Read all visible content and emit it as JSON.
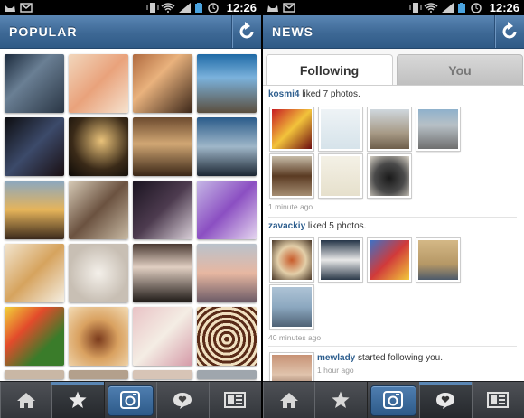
{
  "status": {
    "time": "12:26"
  },
  "popular": {
    "title": "POPULAR",
    "refresh_icon": "refresh-icon"
  },
  "news": {
    "title": "NEWS",
    "refresh_icon": "refresh-icon",
    "tabs": [
      {
        "label": "Following",
        "active": true
      },
      {
        "label": "You",
        "active": false
      }
    ],
    "stories": [
      {
        "user": "kosmi4",
        "action": " liked 7 photos.",
        "time": "1 minute ago",
        "photo_count": 7
      },
      {
        "user": "zavackiy",
        "action": " liked 5 photos.",
        "time": "40 minutes ago",
        "photo_count": 5
      },
      {
        "user": "mewlady",
        "action": " started following you.",
        "time": "1 hour ago"
      }
    ]
  },
  "photo_thumbs": [
    "R0lGODlhUgBOAPcAAAQCBAQGBAQKBAQOBAQSBAwGBAwKBAwOBAwSDAQKDAQODAQSDAQWDAwKDAwOBAwOFAwWDAwaFAwWHAweFAQeFAwiFAwiHBQODBQSDBQWDBwSDBQOBBQSBBQWBBwWFBwaFBweFBQeHBQiHBQiFBQmHBQmFBQqHBwiHBwmHBwuHBwmFBwqJBwuJBwyJCQaFCQeFCQiHCwiHCwmHCQmHCQqJCQuJCQyJCw2JCQ2JCQ6LCw6LCwyLCwuJCwqJDQ6LDQuJDQyLDQ2LCw+LDQ+LDw+NCQ+LDRCNCxCNDxCNDRGNDxKNDxGPDxGNDxCPDxKPDROPDRSPDxSPEROPEROREQ+PEQ6NEQ2LExCPEhGPERGRExKPExKRFRCPFRORFxKTFRKPFRGPFxSTGRKRGxSRGxOPHRWRHxWTIReVHxeTHxaVGRSTGRaVFxaVExWTExSRERWVERaTERWTExaTExSTExaVERSTERiTERiVExqXExeVExiVEx2XExyXEx2ZExuXExmVERmVERaVFRiXFRqZFR2ZFRmXFRyZFx2ZFxuZFxqZFxiXFR+bFyCdFR+dGRiXGxiXGxqXGRyXGR2bGRqZGx2bGR+dGx+dGR6bGRubHRubGxybHRybHx2dHR+dHx+dHR2bIR6dIR2bIR+fHyCfHyCdHSCfIyCfIR+dGyGfGyKfGySfGyKhHSGhHSKhHyKhHSShHyKjHyGhHySjISGhIyGhISKfISSjISOhISOjIySjIyWjJSGhJyOjKSWlIySlIyWlJSOjJSSjJSSlJyalJSalJSWjJyWjKSalKyalKyWlKSenJyinJyelJSmnJyqpJSipIyinISejISWlHyalHyelISinIymnJSupJyupKSmnKSupKSinKyipLymnLyqpLSqnLSinKyqnKyupLSupMyyrMSyrLyurLSyrKSytKy2tLS6tLy2tLSyrMS6tMy6tNS+tMy2rNzGvNzCvOTGvNTCtMS+vMzCvMzGvMzKvNTOxNTGvMzGxMTCvMTCtMzKxNTOzNTKxNTGxNzKxNzOxOTOxNzSxNzOzNzSzNTSzOTOzOzSzOzazOzazOTazOTWzOTW1OzW1OTa1Oze1PTe1Pzm3Pzi3PTi3PTm3PTe3Ozi3Pz+/AAAAAAAAAAAAAAAAAAAAAAAAAAAAAAAAAAAAAAAAAAAAAAAAAAAAAAAAAAAAAAAAAAAAAAAAAAAAAAAAAAAAAAAAAAAAAAAAAAAAAAAAAAAAAAAAAAAAAAAAAAAAAAAAAAAAAAAAAAAACH5BAEAAP8ALAAAAABSAE4AAAj/AP0JHEiwoMGDCBMqXMiwocOEACJKjEiRYkOIFitm3Agxo8WPIEOKHEmSY0WLKFOqXMmyZUqNEmFqfDmwpsubOHPqtMkzJMigQoMSHUq0qNGjSJMqXcr0aNOPO/XR3MlPnz590SJN+vdsUiR+9KhdMxfrX7tj4KRN+GfuWDNi0cpVm0SXLt1V1f6xUwVt0lOngAMLHky4sGHDPKMMLOcPaoAD+qBB65du3bd2m4Q924fv3z5vw3hFu8xP3b9z5oypw3dOXjps4M6dG5QOW7lwwhY5Hr1u1TNnmEx9KkS8uHHjUdPp3m1s0jp96Pjxw8ZvHT4kcdTp6+dPUjpz/MLx/8M2SfO+WOxDZ8vWbZ8mC5LWxfJnUyhj9ZM4saPkDhs+cAC6J+CA+tz3Xj59PNPOOe3MYUMMvESwzR/zzMNOIN10Y4U/lwT7Tiy8AQvtOu/IkgxzFOlSjCp/2KMKHdBw8kwrGjBgASU0HYOLc/PQ+HuI/gIxsTRZy3I0KQCHFhLMrq0k04+iy67GD+kvPIlPcUEGo2+qzoQ0PghMNLQhAQkcUdOlt8Qd3gADP/4QyM/8/zTD8JcAgeQ9Q8Gq0dWckKi21Q34UvLRCzz7PFDCAT7UwsB+l78X/D6EsjqSD5q+HHDDFE+vQhwEHDy1vPMKKjhXJqF1QB68wDQa+WB9DKhDkixFMOYIB/Ayj0ZrtJIM8Cc04rA8IcT/QDNxxjh+2/xkA/eNjS+hDEjFHLqQsGxGDC+aJvMVpYixEnBMIPvkI8pBD4RQgAGEUoMq08GdcFNmEAGvGNnPuRQ5EsMhNLHlZUA88+CBTSCH6wUoVpCOQP8ZHQMcFC7MCkAqlNlglPcTMk4UZUqC+rjRNCjcNLLA8+pAnmwP2Ajr8YFTWVBgBjYJPI/z/FY5bfTUJXgbBpfAIoLAx+JMlNFPLBfkYm4L5xxBFGeO9gi3yCQbzjY6fHRPCoE0YdNeHDWsDKD1RfLHxKu+Dx7a5e2AwgwXTTKdmCjCHGhfBjcUbrt2STVAcA3fwwcG0LXdq4Bw7dYAJ2ALO84JjwcJMfMJNA5hhfGuoZS8BWo7sj8gRSwCbwpHChPBYFIhVTLXc4LwEBgAYhoQgSCAN4gLP4iB2KQcpA3fcagWyzvbbbcGJ/DZPvJfBBrIHt1d8eOpzbQT7y3SePNRwBdfnChI/6SqUdrBfG6YVUVRTcs0+g3yDV8ZRD6gcwQKwaaPQ8DWwKgtEQE7ACnEZTwm37oULAGRkGwF4gjCmJYVIzhnSJc4WA3xhAeDyKAnCA9ygDgMUAlYPX77fw7HWIr4gB4/ZHAXfe8Afh8JfPfKQ3+Iu4KxoHqvj+mQMTDgcgr3A2H6+8/Ax6ImQEjGQB+pjBwzH1qUFh5pxoUgAPR4NgnEVNlXULcoHoaXi4AiLnYg2CHnYVvEWYt4xpJBUkvd6M04CYg/Lxq1j0o1nYcC4tZABMiDeBnmDtB4iFXQkBo9KpjjtfKv0o8CCRXEBbIvmz5akEwu2dGwLI4hEAIw9nfSlvtzU1kiVw+5m0yrTw2Ze8xgdDjdqxNxFAcv+OpybJk3wD5HHIhObsWBlI6T7x/Sl/FVGGtHXpUtlSA6SHgCIx1aXuzBhpZQdEwnBR4TcBMskkJIc9fyUJ3Q9RDJ+NT3PcAImtVExXEzuRnxB6Ib8aDK6p3LBAAAP3fAhV9nlZ4AoTAAVQxwiBxrAsOiGn1gT+OmWHF6PaT5m+9YKglNe9RmTLwHp5dYyrT1QTJ82/+B96uQu2f5NVgr/Dw78NiPB7FlGuFKx9YyjgsUFixe2NsHwagZI5xoAlOGpEEFkkZBYOVSsvXzvd2Z0hEuq73m78kVcHE4BP+PD6TjWbG/ezzlBW4BQaxxd2E3w0O7BZJbUyfeU8umZhaI0HUWnLQQ0/C0uvVRJm8TRcAdCTd5t6TYwwAUvEq4TQgBIw+KIONSZvv8rHzkg+xEgn8AaYgCGUsKXc6YnTjDBAwdDYj3Q6VGRiS3V9Z3tqkbCrjNp/n42Qj5kQ1goUa1bT7ADpWwokfCzyc6HLEP7dOrfpHa1sy7pEkjCaN7QKOBdrN+JRZ69s0R5iIOVzX2jbhP0gpK0vLaw1VrzP6HsDTcCSVb4Ie3+Mb4ofs7q4h6PDTfZ2BttkMdXLkYYjy9yAJKCYnsmpJzsXtHCXRN0XpjKNa+ee5y69/OPFcwNGazpFkUnzj0+PeGsXjeIe+FiJiJuLpxVjZbbJSW+/8e1i1+gkjeGznb4+BhhFhRfoWgHtNlrBYcmo2IVZHpfPFXdj8cQm3rSf9X4Fj0xlYfX5ceh/OAgaP7XfbVepiqRiDDsnVK0yEwzk7/ZwjhkYdOfH5yVlcCrwt0Zpdp42FqzHkFFo1/cJVTizTDGdVZZlPhz1AVaLMOl5WrKM8hMtxSdfmvPmdhOb/wnShVB6uEbXVGJmLjajcxFJOF1Tx+L5bs1kK1Wv3bhIVcxDFBtknRuomC1ARWqeupK9Lp6jxhcqHDQxYvhNt+z61Ft/GlGeVbXjVK+sZ7WmENUtVh11CaH9pb80RmsuTCUyX+bvO30uGi1NgIXYNlaQ35A4B3wN7rvsfd3BLL2ad/PD3j+kzvlvR6Y+ZPT9lpVfncF+XtIuo9yf1t97vfg/x/sKZO6nypXv0qTyXkwg/fY19MwYvM39lwTfRC3h8Mtq9tffNPfX+XPvPzq1H1SsPn2feZHDwqzk5lodxnM7n3FSnPnMoy2j55k2wcNnl/3XPI/uT5tbU0n3o3n8Nwtq+vJ8+yb9LaHDQbi8EFOMvrvZH1j4pmt7RjYyT5ePlX+hdonmx/YV9WYd7oxIsFlzT2OqFR0Hyw1tnZPLn/m9Ti7fhLnxkoHr12fw67d/fzyPZx7u0wmjd28B8+4Xzmr2e/+N9R/+AOZd2enlk92ZTKPvn6OMnYjr5umLmm3tbaM+zj3TLHfaB4P3wH7mr/tvVKlG9Ny//mn+92vm3vf6xf37V8f6I07d5bS9+x8+tD2jt2/9sb/56fn9+eH9BGntjEGP+9Nd/fWDe/f9/+X3p73XuJ/FnDFkR3nBv83j1gHcfmfvp3+xzV7HR++38SwdeO53mWeX3P3vzpvT6n7PdfvTF18/PpsZxt8ywF3j+dfc3VrT3Y0wX+7yzTH2l70AbRvU5Xa9Ncar3fAsX9PuW73F8Hv61v8v+Lx9e9WXbfpbdff5Lz72+ZYy+9VnXvzx0N5y1eMSfs5O/vvf6Py/ZO+7wT51H2Cwy3dr7Hs7+2u1yR7D91fZdVq03zLmvXjdKx+5jsvlsZ02OtVvVh2l+rv2X/1h9cw5/J0e6n74fdt3qx77GiebyZ3nHPnffWNWoyTPzOmHzbrfs7r29ZPv/yH5rq/DvXfZ+65e+9n/k2Z1v+j/cVcD7vT9ZH79uvPe9p6HeVF1Dzvs3WJ7dfXmVbDs7tf+n9e57O3nsmbp5mLP3gr9fX+fXqdq8zF55v3Oy3/f2Y2/5+r/jxd7jzj4y/a+C/dvGzxL3k/jd/vj+r37aP2m/ktn0p9Vo93a/57z8LuvdrQtnPvI+Xz5u3OnS6a1d5i8vM9eR3cfdv2z2qf6t6f8Pn+79H/fj+HyJ+/j/Jv+l5D2gef/vCDfvTPHuE5e07l3LuAO+z2vPb2rCv7/e++3u+rbzdJt/f99p/dfb/55+/Z2fv2Xvtr/f/9f5/nr/uP/9+AMA7i3AAAAOw==",
    "R0lGODlhUgBOAPcAAAQCBAQGBAQKBAQOBAQSBAwGBAwKBAwOBAwSDAQKDAQODAQSDAQWDAwKDAwOBAwOFAwWDAwaFAwWHAweFAQeFAwiFAwiHBQODBQSDBQWDBwSDBQOBBQSBBQWBBwWFBwaFBweFBQeHBQiHBQiFBQmHBQmFBQqHBwiHBwmHBwuHBwmFBwqJBwuJBwyJCQaFCQeFCQiHCwiHCwmHCQmHCQqJCQuJCQyJCw2JCQ2JCQ6LCw6LCwyLCwuJCwqJDQ6LDQuJDQyLDQ2LCw+LDQ+LDw+NCQ+LDRCNCxCNDxCNDRGNDxKNDxGPDxGNDxCPDxKPDROPDRSPDxSPEROPEROREQ+PEQ6NEQ2LExCPEhGPERGRExKPExKRFRCPFRORFxKTFRKPFRGPFxSTGRKRGxSRGxOPHRWRHxWTIReVHxeTHxaVGRSTGRaVFxaVExWTExSRERWVERaTERWTExaTExSTExaVERSTERiTERiVExqXExeVExiVEx2XExyXEx2ZExuXExmVERmVERaVFRiXFRqZFR2ZFRmXFRyZFx2ZFxuZFxqZFxiXFR+bFyCdFR+dGRiXGxiXGxqXGRyXGR2bGRqZGx2bGR+dGx+dGR6bGRubHRubGxybHRybHx2dHR+dHx+dHR2bIR6dIR2bIR+fHyCfHyCdHSCfIyCfIR+dGyGfGyKfGySfGyKhHSGhHSKhHyKhHSShHyKjHyGhHySjISGhIyGhISKfISSjISOhISOjIySjIyWjJSGhJyOjKSWlIySlIyWlJSOjJSSjJSSlJyalJSalJSWjJyWjKSalKyalKyWlKSenJyinJyelJSmnJyqpJSipIyinISejISWlHyalHyelISinIymnJSupJyupKSmnKSupKSinKyipLymnLyqpLSqnLSinKyqnKyupLSupMyyrMSyrLyurLSyrKSytKy2tLS6tLy2tLSyrMS6tMy6tNS+tMy2rNzGvNzCvOTGvNTCtMS+vMzCvMzGvMzKvNTOxNTGvMzGxMTCvMTCtMzKxNTOzNTKxNTGxNzKxNzOxOTOxNzSxNzOzNzSzNTSzOTOzOzSzOzazOzazOTazOTWzOTW1OzW1OTa1Oze1PTe1Pzm3Pzi3PTi3PTm3PTe3Ozi3Pz+/AAAAAAAAAAAAAAAAAAAAAAAAAAAAAAAAAAAAAAAAAAAAAAAAAAAAAAAAAAAAAAAAAAAAAAAAAAAAAAAAAAAAAAAAAAAAAAAAAAAAAAAAAAAAAAAAAAAAAAAAAAAAAAAAAAAAAAAAAAAACH5BAEAAP8ALAAAAABSAE4AAAj/AP0JHEiwoMGDCBMqXMiwocOEACJKjEiRYkOIFitm3Agxo8WPIEOKHEmSY0WLKFOqXMmyZUqNEmFqfDmwpsubOHPqtMkzJMigQoMSHUq0qNGjSJMqXcr0aNOPO/XR3MlPnz590SJN+vdsUiR+9KhdMxfrX7tj4KRN+GfuWDNi0cpVm0SXLt1V1f6xUwVt0lOngAMLHky4sGHDPKMMLOcPaoAD+qBB65du3bd2m4Q924fv3z5vw3hFu8xP3b9z5oypw3dOXjps4M6dG5QOW7lwwhY5Hr1u1TNnmEx9KkS8uHHjUdPp3m1s0jp96Pjxw8ZvHT4kcdTp6+dPUjpz/MLx/8M2SfO+WOxDZ8vWbZ8mC5LWxfJnUyhj9ZM4saPkDhs+cAC6J+CA+tz3Xj59PNPOOe3MYUMMvESwzR/zzMNOIN10Y4U/lwT7Tiy8AQvtOu/IkgxzFOlSjCp/2KMKHdBw8kwrGjBgASU0HYOLc/PQ+HuI/gIxsTRZy3I0KQCHFhLMrq0k04+iy67GD+kvPIlPcUEGo2+qzoQ0PghMNLQhAQkcUdOlt8Qd3gADP/4QyM/8/zTD8JcAgeQ9Q8Gq0dWckKi21Q34UvLRCzz7PFDCAT7UwsB+l78X/D6EsjqSD5q+HHDDFE+vQhwEHDy1vPMKKjhXJqF1QB68wDQa+WB9DKhDkixFMOYIB/Ayj0ZrtJIM8Cc04rA8IcT/QDNxxjh+2/xkA/eNjS+hDEjFHLqQsGxGDC+aJvMVpYixEnBMIPvkI8pBD4RQgAGEUoMq08GdcFNmEAGvGNnPuRQ5EsMhNLHlZUA88+CBTSCH6wUoVpCOQP8ZHQMcFC7MCkAqlNlglPcTMk4UZUqC+rjRNCjcNLLA8+pAnmwP2Ajr8YFTWVBgBjYJPI/z/FY5bfTUJXgbBpfAIoLAx+JMlNFPLBfkYm4L5xxBFGeO9gi3yCQbzjY6fHRPCoE0YdNeHDWsDKD1RfLHxKu+Dx7a5e2AwgwXTTKdmCjCHGhfBjcUbrt2STVAcA3fwwcG0LXdq4Bw7dYAJ2ALO84JjwcJMfMJNA5hhfGuoZS8BWo7sj8gRSwCbwpHChPBYFIhVTLXc4LwEBgAYhoQgSCAN4gLP4iB2KQcpA3fcagWyzvbbbcGJ/DZPvJfBBrIHt1d8eOpzbQT7y3SePNRwBdfnChI/6SqUdrBfG6YVUVRTcs0+g3yDV8ZRD6gcwQKwaaPQ8DWwKgtEQE7ACnEZTwm37oULAGRkGwF4gjCmJYVIzhnSJc4WA3xhAeDyKAnCA9ygDgMUAlYPX77fw7HWIr4gB4/ZHAXfe8Afh8JfPfKQ3+Iu4KxoHqvj+mQMTDgcgr3A2H6+8/Ax6ImQEjGQB+pjBwzH1qUFh5pxoUgAPR4NgnEVNlXULcoHoaXi4AiLnYg2CHnYVvEWYt4xpJBUkvd6M04CYg/Lxq1j0o1nYcC4tZABMiDeBnmDtB4iFXQkBo9KpjjtfKv0o8CCRXEBbIvmz5akEwu2dGwLI4hEAIw9nfSlvtzU1kiVw+5m0yrTw2Ze8xgdDjdqxNxFAcv+OpybJk3wD5HHIhObsWBlI6T7x/Sl/FVGGtHXpUtlSA6SHgCIx1aXuzBhpZQdEwnBR4TcBMskkJIc9fyUJ3Q9RDJ+NT3PcAImtVExXEzuRnxB6Ib8aDK6p3LBAAAP3fAhV9nlZ4AoTAAVQxwiBxrAsOiGn1gT+OmWHF6PaT5m+9YKglNe9RmTLwHp5dYyrT1QTJ82/+B96uQu2f5NVgr/Dw78NiPB7FlGuFKx9YyjgsUFixe2NsHwagZI5xoAlOGpEEFkkZBYOVSsvXzvd2Z0hEuq73m78kVcHE4BP+PD6TjWbG/ezzlBW4BQaxxd2E3w0O7BZJbUyfeU8umZhaI0HUWnLQQ0/C0uvVRJm8TRcAdCTd5t6TYwwAUvEq4TQgBIw+KIONSZvv8rHzkg+xEgn8AaYgCGUsKXc6YnTjDBAwdDYj3Q6VGRiS3V9Z3tqkbCrjNp/n42Qj5kQ1goUa1bT7ADpWwokfCzyc6HLEP7dOrfpHa1sy7pEkjCaN7QKOBdrN+JRZ69s0R5iIOVzX2jbhP0gpK0vLaw1VrzP6HsDTcCSVb4Ie3+Mb4ofs7q4h6PDTfZ2BttkMdXLkYYjy9yAJKCYnsmpJzsXtHCXRN0XpjKNa+ee5y69/OPFcwNGazpFkUnzj0+PeGsXjeIe+FiJiJuLpxVjZbbJSW+/8e1i1+gkjeGznb4+BhhFhRfoWgHtNlrBYcmo2IVZHpfPFXdj8cQm3rSf9X4Fj0xlYfX5ceh/OAgaP7XfbVepiqRiDDsnVK0yEwzk7/ZwjhkYdOfH5yVlcCrwt0Zpdp42FqzHkFFo1/cJVTizTDGdVZZlPhz1AVaLMOl5WrKM8hMtxSdfmvPmdhOb/wnShVB6uEbXVGJmLjajcxFJOF1Tx+L5bs1kK1Wv3bhIVcxDFBtknRuomC1ARWqeupK9Lp6jxhcqHDQxYvhNt+z61Ft/GlGeVbXjVK+sZ7WmENUtVh11CaH9pb80RmsuTCUyX+bvO30uGi1NgIXYNlaQ35A4B3wN7rvsfd3BLL2ad/PD3j+kzvlvR6Y+ZPT9lpVfncF+XtIuo9yf1t97vfg/x/sKZO6nypXv0qTyXkwg/fY19MwYvM39lwTfRC3h8Mtq9tffNPfX+XPvPzq1H1SsPn2feZHDwqzk5lodxnM7n3FSnPnMoy2j55k2wcNnl/3XPI/uT5tbU0n3o3n8Nwtq+vJ8+yb9LaHDQbi8EFOMvrvZH1j4pmt7RjYyT5ePlX+hdonmx/YV9WYd7oxIsFlzT2OqFR0Hyw1tnZPLn/m9Ti7fhLnxkoHr12fw67d/fzyPZx7u0wmjd28B8+4Xzmr2e/+N9R/+AOZd2enlk92ZTKPvn6OMnYjr5umLmm3tbaM+zj3TLHfaB4P3wH7mr/tvVKlG9Ny//mn+92vm3vf6xf37V8f6I07d5bS9+x8+tD2jt2/9sb/56fn9+eH9BGntjEGP+9Nd/fWDe/f9/+X3p73XuJ/FnDFkR3nBv83j1gHcfmfvp3+xzV7HR++38SwdeO53mWeX3P3vzpvT6n7PdfvTF18/PpsZxt8ywF3j+dfc3VrT3Y0wX+7yzTH2l70AbRvU5Xa9Ncar3fAsX9PuW73F8Hv61v8v+Lx9e9WXbfpbdff5Lz72+ZYy+9VnXvzx0N5y1eMSfs5O/vvf6Py/ZO+7wT51H2Cwy3dr7Hs7+2u1yR7D91fZdVq03zLmvXjdKx+5jsvlsZ02OtVvVh2l+rv2X/1h9cw5/J0e6n74fdt3qx77GiebyZ3nHPnffWNWoyTPzOmHzbrfs7r29ZPv/yH5rq/DvXfZ+65e+9n/k2Z1v+j/cVcD7vT9ZH79uvPe9p6HeVF1Dzvs3WJ7dfXmVbDs7tf+n9e57O3nsmbp5mLP3gr9fX+fXqdq8zF55v3Oy3/f2Y2/5+r/jxd7jzj4y/a+C/dvGzxL3k/jd/vj+r37aP2m/ktn0p9Vo93a/57z8LuvdrQtnPvI+Xz5u3OnS6a1d5i8vM9eR3cfdv2z2qf6t6f8Pn+79H/fj+HyJ+/j/Jv+l5D2gef/vCDfvTPHuE5e07l3LuAO+z2vPb2rCv7/e++3u+rbzdJt/f99p/dfb/55+/Z2fv2Xvtr/f/9f5/nr/uP/9+AMA7i3AAAAOw=="
  ]
}
